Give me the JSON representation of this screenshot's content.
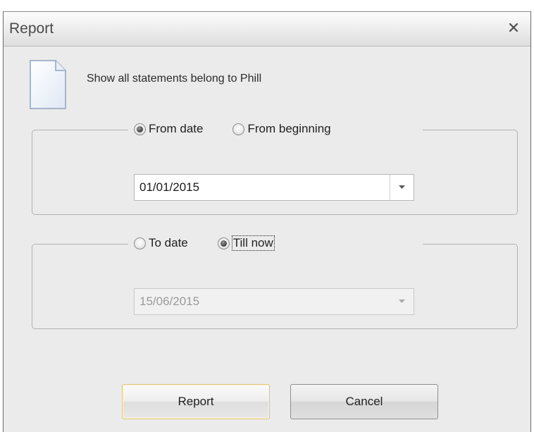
{
  "window": {
    "title": "Report"
  },
  "icons": {
    "close": "close-icon",
    "document": "document-icon",
    "dropdown": "chevron-down-icon"
  },
  "description": "Show all statements belong to Phill",
  "from_group": {
    "options": [
      {
        "label": "From date",
        "selected": true
      },
      {
        "label": "From beginning",
        "selected": false
      }
    ],
    "date_value": "01/01/2015",
    "enabled": true
  },
  "to_group": {
    "options": [
      {
        "label": "To date",
        "selected": false
      },
      {
        "label": "Till now",
        "selected": true,
        "focused": true
      }
    ],
    "date_value": "15/06/2015",
    "enabled": false
  },
  "buttons": {
    "report": "Report",
    "cancel": "Cancel"
  },
  "colors": {
    "dialog_bg": "#ebebeb",
    "default_button_border": "#e3c27a"
  }
}
